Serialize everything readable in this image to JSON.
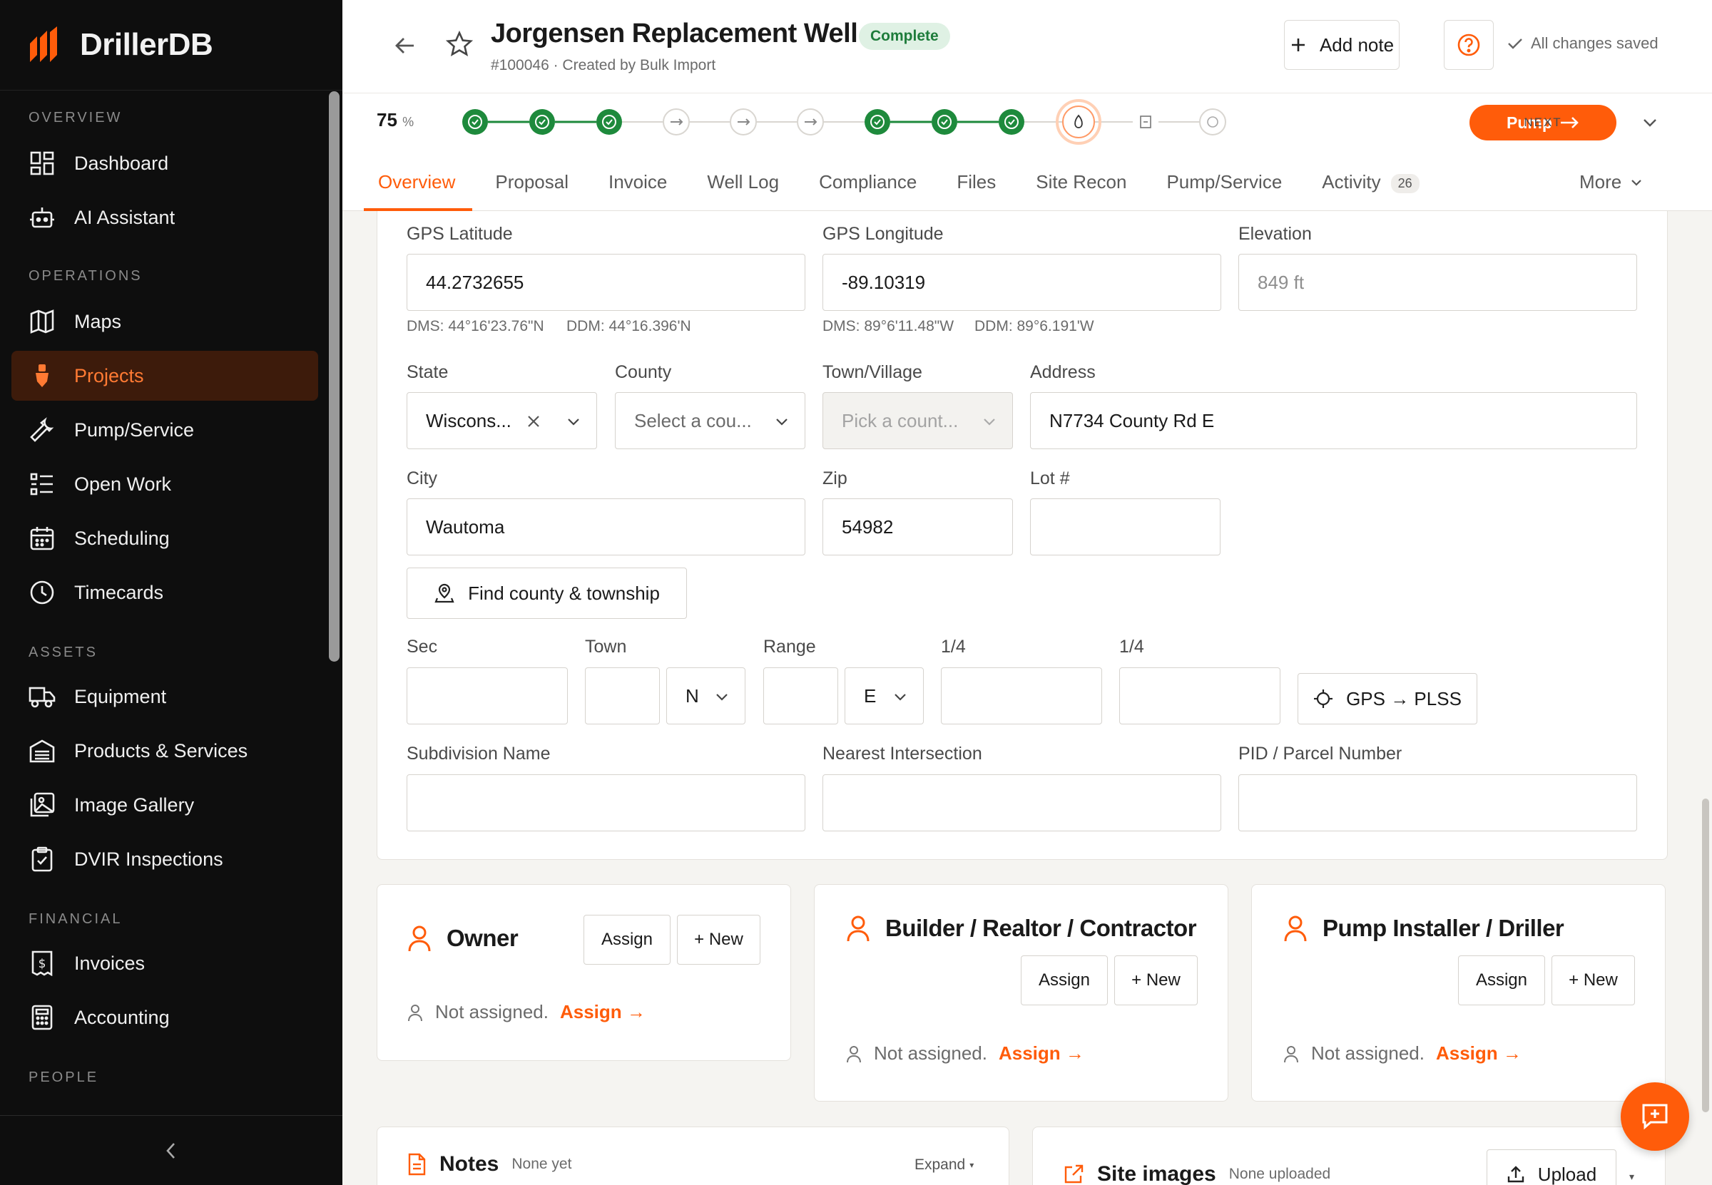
{
  "brand": {
    "name": "DrillerDB",
    "accent": "#ff5c0a"
  },
  "sidebar": {
    "sections": [
      {
        "label": "OVERVIEW",
        "items": [
          {
            "label": "Dashboard",
            "icon": "dashboard-icon"
          },
          {
            "label": "AI Assistant",
            "icon": "robot-icon"
          }
        ]
      },
      {
        "label": "OPERATIONS",
        "items": [
          {
            "label": "Maps",
            "icon": "map-icon"
          },
          {
            "label": "Projects",
            "icon": "drill-icon",
            "active": true
          },
          {
            "label": "Pump/Service",
            "icon": "wrench-icon"
          },
          {
            "label": "Open Work",
            "icon": "list-icon"
          },
          {
            "label": "Scheduling",
            "icon": "calendar-icon"
          },
          {
            "label": "Timecards",
            "icon": "clock-icon"
          }
        ]
      },
      {
        "label": "ASSETS",
        "items": [
          {
            "label": "Equipment",
            "icon": "truck-icon"
          },
          {
            "label": "Products & Services",
            "icon": "warehouse-icon"
          },
          {
            "label": "Image Gallery",
            "icon": "image-icon"
          },
          {
            "label": "DVIR Inspections",
            "icon": "clipboard-icon"
          }
        ]
      },
      {
        "label": "FINANCIAL",
        "items": [
          {
            "label": "Invoices",
            "icon": "invoice-icon"
          },
          {
            "label": "Accounting",
            "icon": "calculator-icon"
          }
        ]
      },
      {
        "label": "PEOPLE",
        "items": []
      }
    ]
  },
  "header": {
    "title": "Jorgensen Replacement Well",
    "status": "Complete",
    "subtitle": "#100046 · Created by Bulk Import",
    "add_note": "Add note",
    "saved": "All changes saved"
  },
  "progress": {
    "percent": "75",
    "unit": "%",
    "steps": [
      "complete",
      "complete",
      "complete",
      "skipped",
      "skipped",
      "skipped",
      "complete",
      "complete",
      "complete",
      "current",
      "pending",
      "pending"
    ],
    "next_label": "NEXT",
    "next_step": "Pump"
  },
  "tabs": [
    {
      "label": "Overview",
      "active": true
    },
    {
      "label": "Proposal"
    },
    {
      "label": "Invoice"
    },
    {
      "label": "Well Log"
    },
    {
      "label": "Compliance"
    },
    {
      "label": "Files"
    },
    {
      "label": "Site Recon"
    },
    {
      "label": "Pump/Service"
    },
    {
      "label": "Activity",
      "count": "26"
    }
  ],
  "more_label": "More",
  "location": {
    "gps_lat_label": "GPS Latitude",
    "gps_lat": "44.2732655",
    "gps_lat_dms": "DMS: 44°16'23.76\"N",
    "gps_lat_ddm": "DDM: 44°16.396'N",
    "gps_lon_label": "GPS Longitude",
    "gps_lon": "-89.10319",
    "gps_lon_dms": "DMS: 89°6'11.48\"W",
    "gps_lon_ddm": "DDM: 89°6.191'W",
    "elevation_label": "Elevation",
    "elevation": "849 ft",
    "state_label": "State",
    "state": "Wiscons...",
    "county_label": "County",
    "county_placeholder": "Select a cou...",
    "town_label": "Town/Village",
    "town_placeholder": "Pick a count...",
    "address_label": "Address",
    "address": "N7734 County Rd E",
    "city_label": "City",
    "city": "Wautoma",
    "zip_label": "Zip",
    "zip": "54982",
    "lot_label": "Lot #",
    "find_button": "Find county & township",
    "sec_label": "Sec",
    "townrow_label": "Town",
    "town_dir": "N",
    "range_label": "Range",
    "range_dir": "E",
    "quarter1_label": "1/4",
    "quarter2_label": "1/4",
    "gps_plss_button": "GPS → PLSS",
    "subdivision_label": "Subdivision Name",
    "intersection_label": "Nearest Intersection",
    "pid_label": "PID / Parcel Number"
  },
  "parties": [
    {
      "title": "Owner",
      "assign": "Assign",
      "new": "+ New",
      "empty": "Not assigned.",
      "link": "Assign →"
    },
    {
      "title": "Builder / Realtor / Contractor",
      "assign": "Assign",
      "new": "+ New",
      "empty": "Not assigned.",
      "link": "Assign →"
    },
    {
      "title": "Pump Installer / Driller",
      "assign": "Assign",
      "new": "+ New",
      "empty": "Not assigned.",
      "link": "Assign →"
    }
  ],
  "notes": {
    "title": "Notes",
    "sub": "None yet",
    "expand": "Expand"
  },
  "site_images": {
    "title": "Site images",
    "sub": "None uploaded",
    "upload": "Upload"
  }
}
